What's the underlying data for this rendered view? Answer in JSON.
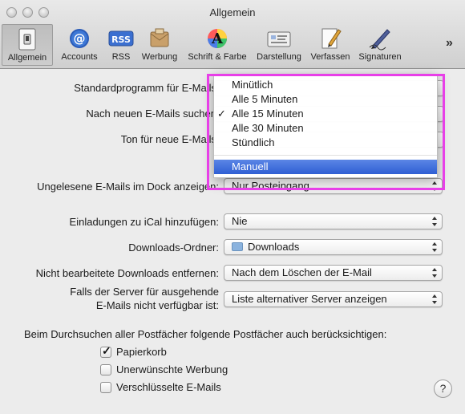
{
  "window": {
    "title": "Allgemein"
  },
  "toolbar": {
    "items": [
      {
        "label": "Allgemein",
        "icon": "switch-icon",
        "active": true
      },
      {
        "label": "Accounts",
        "icon": "at-sign-icon"
      },
      {
        "label": "RSS",
        "icon": "rss-icon"
      },
      {
        "label": "Werbung",
        "icon": "junk-mail-icon"
      },
      {
        "label": "Schrift & Farbe",
        "icon": "font-color-icon"
      },
      {
        "label": "Darstellung",
        "icon": "viewing-icon"
      },
      {
        "label": "Verfassen",
        "icon": "compose-icon"
      },
      {
        "label": "Signaturen",
        "icon": "signature-pen-icon"
      }
    ],
    "more": "»"
  },
  "settings": {
    "default_mail_label": "Standardprogramm für E-Mails",
    "check_new_label": "Nach neuen E-Mails suchen",
    "new_mail_sound_label": "Ton für neue E-Mails",
    "dock_unread_label": "Ungelesene E-Mails im Dock anzeigen:",
    "dock_unread_value": "Nur Posteingang",
    "ical_label": "Einladungen zu iCal hinzufügen:",
    "ical_value": "Nie",
    "downloads_label": "Downloads-Ordner:",
    "downloads_value": "Downloads",
    "remove_downloads_label": "Nicht bearbeitete Downloads entfernen:",
    "remove_downloads_value": "Nach dem Löschen der E-Mail",
    "server_unavailable_label_1": "Falls der Server für ausgehende",
    "server_unavailable_label_2": "E-Mails nicht verfügbar ist:",
    "server_unavailable_value": "Liste alternativer Server anzeigen",
    "search_mailboxes_label": "Beim Durchsuchen aller Postfächer folgende Postfächer auch berücksichtigen:",
    "checkboxes": [
      {
        "label": "Papierkorb",
        "checked": true
      },
      {
        "label": "Unerwünschte Werbung",
        "checked": false
      },
      {
        "label": "Verschlüsselte E-Mails",
        "checked": false
      }
    ],
    "help": "?"
  },
  "menu": {
    "items": [
      {
        "label": "Minütlich",
        "checked": false
      },
      {
        "label": "Alle 5 Minuten",
        "checked": false
      },
      {
        "label": "Alle 15 Minuten",
        "checked": true
      },
      {
        "label": "Alle 30 Minuten",
        "checked": false
      },
      {
        "label": "Stündlich",
        "checked": false
      }
    ],
    "highlighted": "Manuell",
    "check_mark": "✓"
  },
  "colors": {
    "highlight_box": "#e83fe8",
    "menu_selection": "#3b6bdc"
  }
}
